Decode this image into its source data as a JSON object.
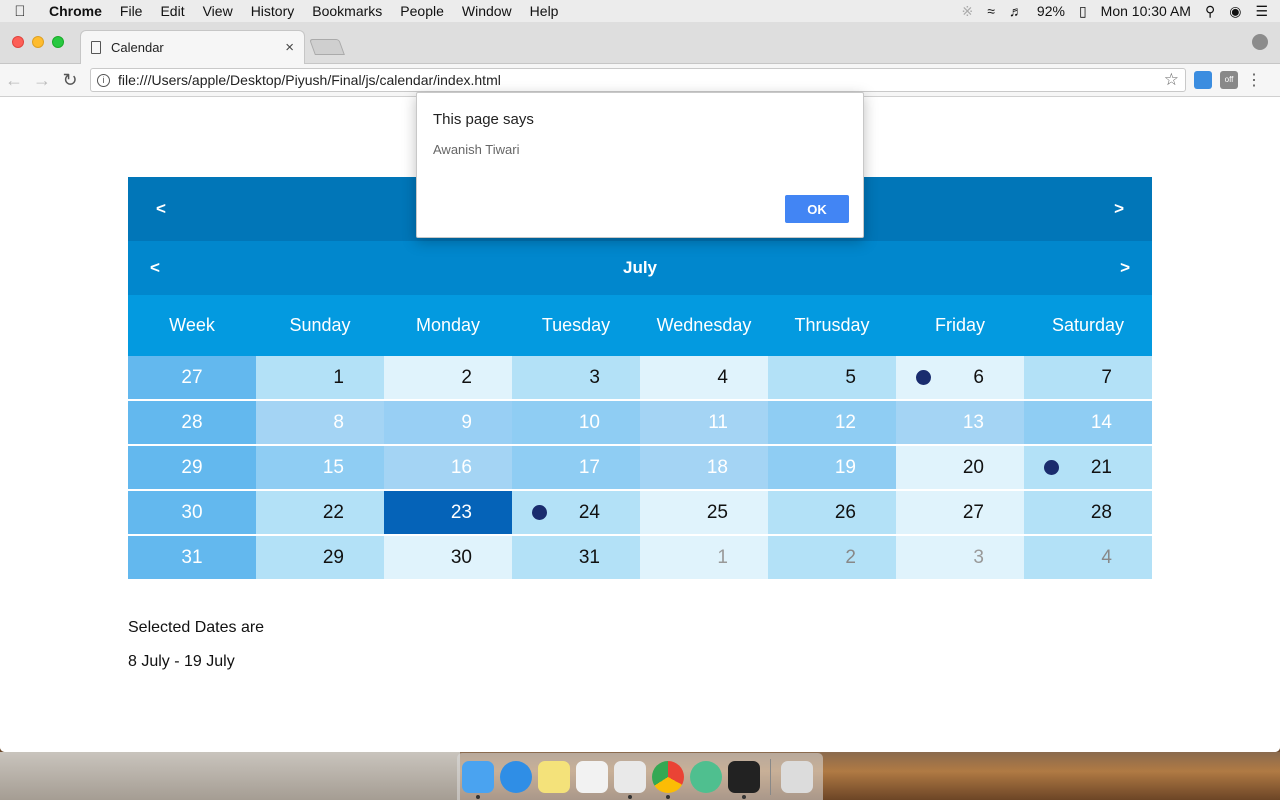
{
  "menubar": {
    "app_name": "Chrome",
    "items": [
      "File",
      "Edit",
      "View",
      "History",
      "Bookmarks",
      "People",
      "Window",
      "Help"
    ],
    "battery": "92%",
    "clock": "Mon 10:30 AM"
  },
  "browser": {
    "tab_title": "Calendar",
    "url": "file:///Users/apple/Desktop/Piyush/Final/js/calendar/index.html",
    "ext_off_label": "off"
  },
  "calendar": {
    "prev_label": "<",
    "next_label": ">",
    "month": "July",
    "headers": [
      "Week",
      "Sunday",
      "Monday",
      "Tuesday",
      "Wednesday",
      "Thrusday",
      "Friday",
      "Saturday"
    ],
    "weeks": [
      {
        "week": "27",
        "days": [
          "1",
          "2",
          "3",
          "4",
          "5",
          "6",
          "7"
        ]
      },
      {
        "week": "28",
        "days": [
          "8",
          "9",
          "10",
          "11",
          "12",
          "13",
          "14"
        ]
      },
      {
        "week": "29",
        "days": [
          "15",
          "16",
          "17",
          "18",
          "19",
          "20",
          "21"
        ]
      },
      {
        "week": "30",
        "days": [
          "22",
          "23",
          "24",
          "25",
          "26",
          "27",
          "28"
        ]
      },
      {
        "week": "31",
        "days": [
          "29",
          "30",
          "31",
          "1",
          "2",
          "3",
          "4"
        ]
      }
    ],
    "colors": {
      "year_bar": "#0176b8",
      "month_bar": "#0187cd",
      "header_bar": "#039ae0",
      "week_cell": "#63b8ee",
      "selected_range": [
        "#8fcdf3",
        "#a4d4f4"
      ],
      "today": "#0563b8",
      "event_dot": "#1a2c6e"
    }
  },
  "selection": {
    "label": "Selected Dates are",
    "range": "8 July - 19 July"
  },
  "dialog": {
    "title": "This page says",
    "message": "Awanish Tiwari",
    "ok_label": "OK"
  }
}
